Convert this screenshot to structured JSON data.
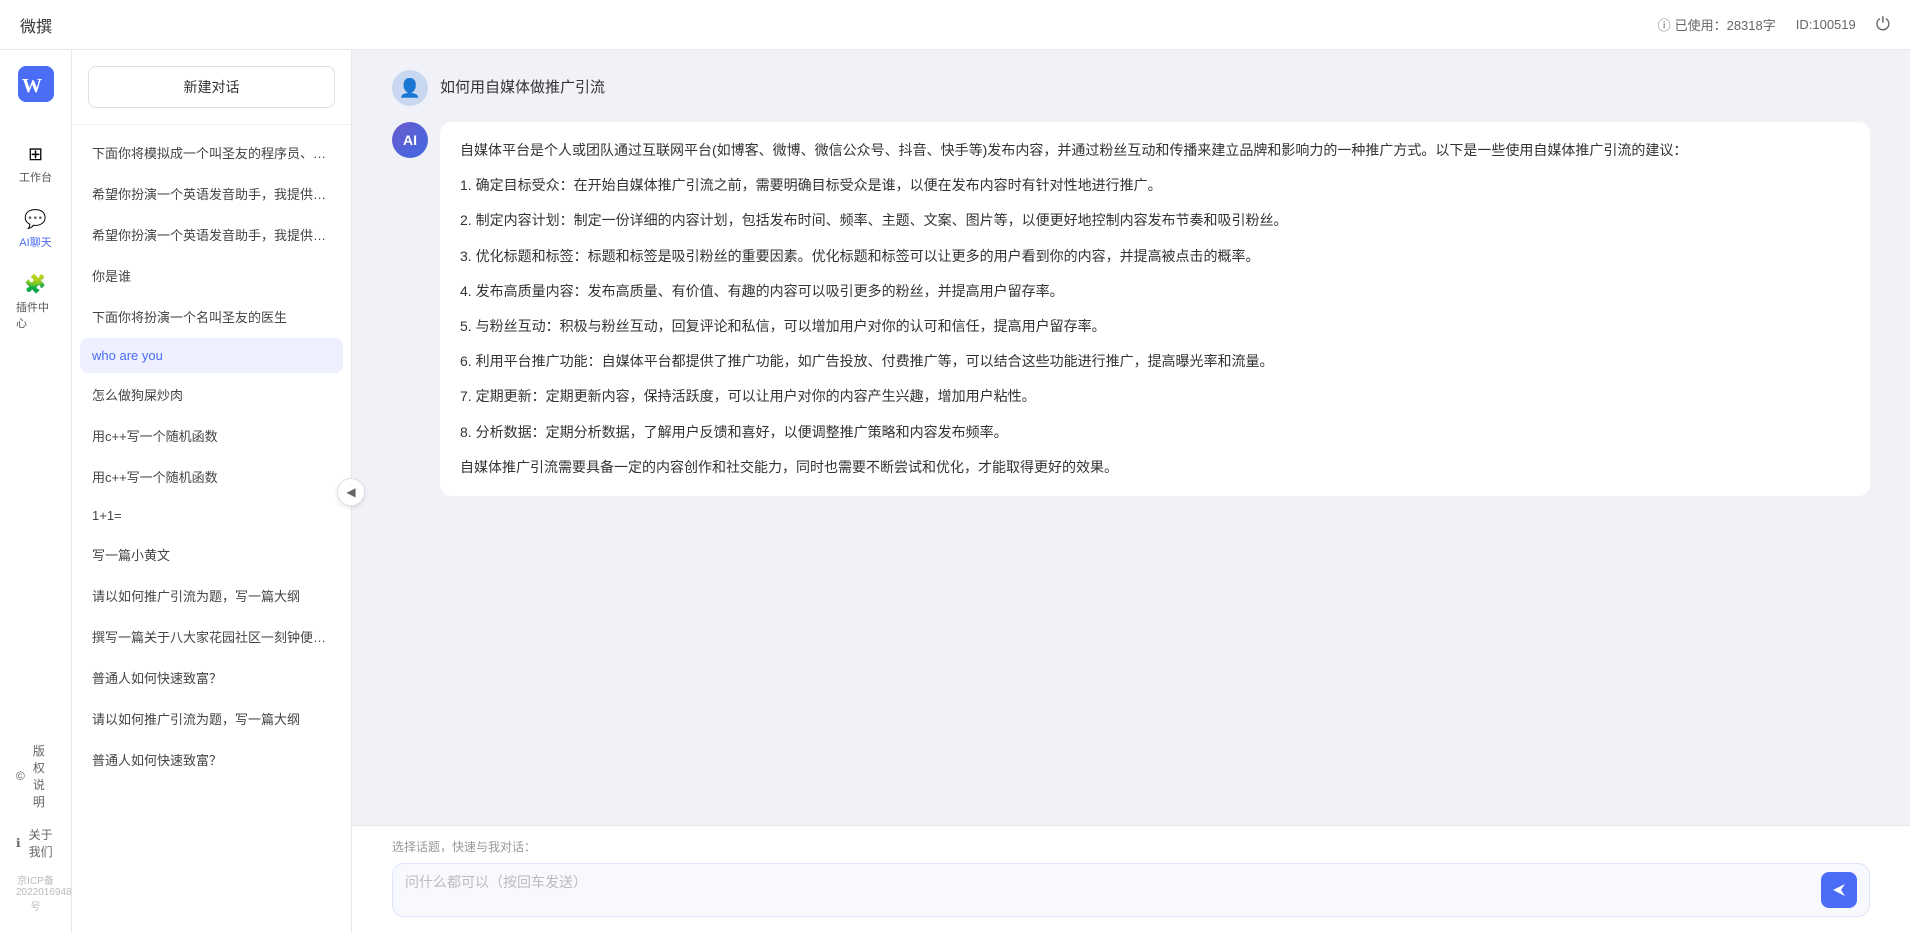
{
  "app": {
    "name": "微撰",
    "logo_text": "微撰"
  },
  "topbar": {
    "title": "微撰",
    "usage_label": "已使用：28318字",
    "id_label": "ID:100519",
    "usage_icon": "ⓘ"
  },
  "sidebar": {
    "items": [
      {
        "id": "workspace",
        "label": "工作台",
        "icon": "⊞"
      },
      {
        "id": "aichat",
        "label": "AI聊天",
        "icon": "💬",
        "active": true
      },
      {
        "id": "plugin",
        "label": "插件中心",
        "icon": "🧩"
      }
    ],
    "bottom_items": [
      {
        "id": "copyright",
        "label": "版权说明",
        "icon": "©"
      },
      {
        "id": "about",
        "label": "关于我们",
        "icon": "ℹ"
      }
    ],
    "icp": "京ICP备2022016948号"
  },
  "conv_panel": {
    "new_btn_label": "新建对话",
    "conversations": [
      {
        "id": 1,
        "text": "下面你将模拟成一个叫圣友的程序员、我说..."
      },
      {
        "id": 2,
        "text": "希望你扮演一个英语发音助手，我提供给你..."
      },
      {
        "id": 3,
        "text": "希望你扮演一个英语发音助手，我提供给你..."
      },
      {
        "id": 4,
        "text": "你是谁"
      },
      {
        "id": 5,
        "text": "下面你将扮演一个名叫圣友的医生"
      },
      {
        "id": 6,
        "text": "who are you",
        "active": true
      },
      {
        "id": 7,
        "text": "怎么做狗屎炒肉"
      },
      {
        "id": 8,
        "text": "用c++写一个随机函数"
      },
      {
        "id": 9,
        "text": "用c++写一个随机函数"
      },
      {
        "id": 10,
        "text": "1+1="
      },
      {
        "id": 11,
        "text": "写一篇小黄文"
      },
      {
        "id": 12,
        "text": "请以如何推广引流为题，写一篇大纲"
      },
      {
        "id": 13,
        "text": "撰写一篇关于八大家花园社区一刻钟便民生..."
      },
      {
        "id": 14,
        "text": "普通人如何快速致富？"
      },
      {
        "id": 15,
        "text": "请以如何推广引流为题，写一篇大纲"
      },
      {
        "id": 16,
        "text": "普通人如何快速致富？"
      }
    ]
  },
  "chat": {
    "user_message": "如何用自媒体做推广引流",
    "ai_response": {
      "paragraphs": [
        "自媒体平台是个人或团队通过互联网平台(如博客、微博、微信公众号、抖音、快手等)发布内容，并通过粉丝互动和传播来建立品牌和影响力的一种推广方式。以下是一些使用自媒体推广引流的建议：",
        "1. 确定目标受众：在开始自媒体推广引流之前，需要明确目标受众是谁，以便在发布内容时有针对性地进行推广。",
        "2. 制定内容计划：制定一份详细的内容计划，包括发布时间、频率、主题、文案、图片等，以便更好地控制内容发布节奏和吸引粉丝。",
        "3. 优化标题和标签：标题和标签是吸引粉丝的重要因素。优化标题和标签可以让更多的用户看到你的内容，并提高被点击的概率。",
        "4. 发布高质量内容：发布高质量、有价值、有趣的内容可以吸引更多的粉丝，并提高用户留存率。",
        "5. 与粉丝互动：积极与粉丝互动，回复评论和私信，可以增加用户对你的认可和信任，提高用户留存率。",
        "6. 利用平台推广功能：自媒体平台都提供了推广功能，如广告投放、付费推广等，可以结合这些功能进行推广，提高曝光率和流量。",
        "7. 定期更新：定期更新内容，保持活跃度，可以让用户对你的内容产生兴趣，增加用户粘性。",
        "8. 分析数据：定期分析数据，了解用户反馈和喜好，以便调整推广策略和内容发布频率。",
        "自媒体推广引流需要具备一定的内容创作和社交能力，同时也需要不断尝试和优化，才能取得更好的效果。"
      ]
    },
    "input_placeholder": "问什么都可以（按回车发送）",
    "quick_topic_label": "选择话题，快速与我对话："
  }
}
